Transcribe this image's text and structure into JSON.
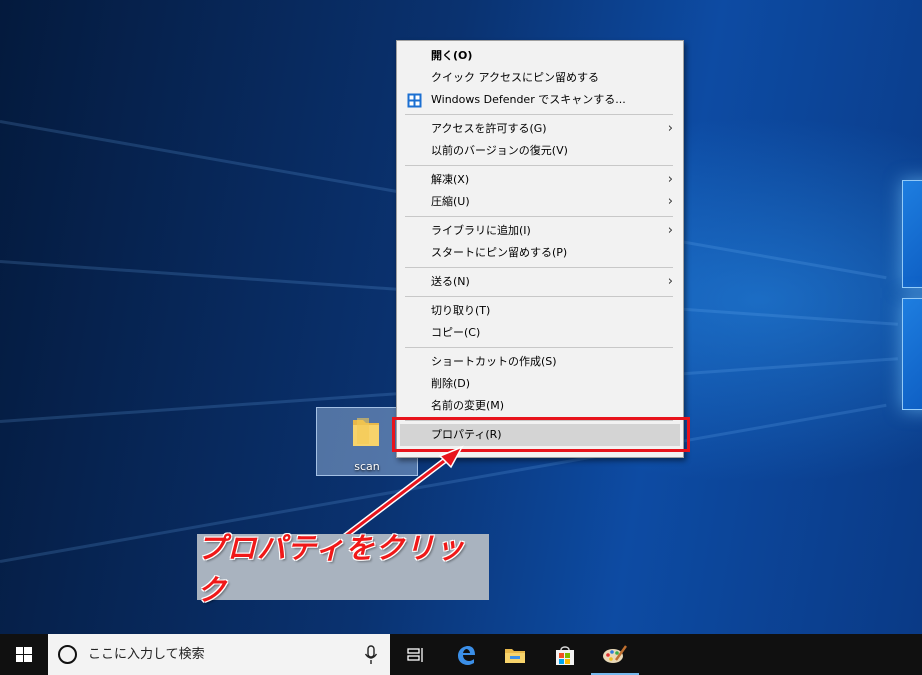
{
  "desktop": {
    "icon_label": "scan"
  },
  "context_menu": {
    "groups": [
      [
        {
          "label": "開く(O)",
          "bold": true
        },
        {
          "label": "クイック アクセスにピン留めする"
        },
        {
          "label": "Windows Defender でスキャンする...",
          "icon": "windows-defender-icon"
        }
      ],
      [
        {
          "label": "アクセスを許可する(G)",
          "submenu": true
        },
        {
          "label": "以前のバージョンの復元(V)"
        }
      ],
      [
        {
          "label": "解凍(X)",
          "submenu": true
        },
        {
          "label": "圧縮(U)",
          "submenu": true
        }
      ],
      [
        {
          "label": "ライブラリに追加(I)",
          "submenu": true
        },
        {
          "label": "スタートにピン留めする(P)"
        }
      ],
      [
        {
          "label": "送る(N)",
          "submenu": true
        }
      ],
      [
        {
          "label": "切り取り(T)"
        },
        {
          "label": "コピー(C)"
        }
      ],
      [
        {
          "label": "ショートカットの作成(S)"
        },
        {
          "label": "削除(D)"
        },
        {
          "label": "名前の変更(M)"
        }
      ],
      [
        {
          "label": "プロパティ(R)",
          "highlighted": true
        }
      ]
    ]
  },
  "callout": {
    "text": "プロパティをクリック"
  },
  "taskbar": {
    "search_placeholder": "ここに入力して検索",
    "pinned": [
      "task-view-icon",
      "edge-icon",
      "file-explorer-icon",
      "store-icon",
      "paint-icon"
    ]
  },
  "colors": {
    "highlight_red": "#e8141c",
    "callout_bg": "#a9b3bf",
    "menu_bg": "#f2f2f2",
    "taskbar_bg": "#101010"
  }
}
